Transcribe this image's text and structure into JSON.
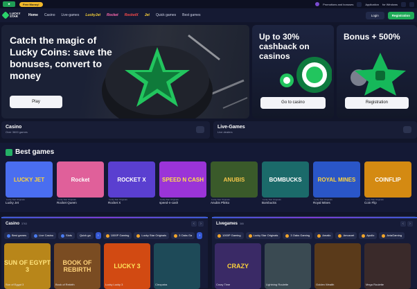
{
  "topbar": {
    "promo": "Free Money!",
    "account_text": "Promotions and bonuses",
    "app_label": "Application",
    "app_sub": "for Windows"
  },
  "nav": {
    "logo_line1": "LUCKY",
    "logo_line2": "STAR",
    "items": [
      "Home",
      "Casino",
      "Live-games",
      "LuckyJet",
      "Rocket",
      "RocketX",
      "Jet",
      "Quick games",
      "Best games"
    ],
    "login": "Login",
    "register": "Registration"
  },
  "hero": {
    "title": "Catch the magic of Lucky Coins: save the bonuses, convert to money",
    "button": "Play"
  },
  "promos": [
    {
      "title": "Up to 30% cashback on casinos",
      "button": "Go to casino"
    },
    {
      "title": "Bonus + 500%",
      "button": "Registration"
    }
  ],
  "categories": [
    {
      "title": "Casino",
      "sub": "Over 3600 games"
    },
    {
      "title": "Live-Games",
      "sub": "Live dealers"
    }
  ],
  "best": {
    "title": "Best games",
    "games": [
      {
        "name": "Lucky Jet",
        "provider": "Lucky Star Originals",
        "thumb": "LUCKY JET",
        "color": "#4a6ef0"
      },
      {
        "name": "Rocket Queen",
        "provider": "Lucky Star Originals",
        "thumb": "Rocket",
        "color": "#e0609a"
      },
      {
        "name": "Rocket X",
        "provider": "Lucky Star Originals",
        "thumb": "ROCKET X",
        "color": "#5a3fd0"
      },
      {
        "name": "speed-n-cash",
        "provider": "Lucky Star Originals",
        "thumb": "SPEED N CASH",
        "color": "#9a34d8"
      },
      {
        "name": "Anubis Plinko",
        "provider": "Lucky Star Originals",
        "thumb": "ANUBIS",
        "color": "#3a5a2a"
      },
      {
        "name": "Bombucks",
        "provider": "Lucky Star Originals",
        "thumb": "BOMBUCKS",
        "color": "#1b6a6a"
      },
      {
        "name": "Royal Mines",
        "provider": "Lucky Star Originals",
        "thumb": "ROYAL MINES",
        "color": "#2a56c8"
      },
      {
        "name": "Coin Flip",
        "provider": "Lucky Star Originals",
        "thumb": "COINFLIP",
        "color": "#d48a12"
      }
    ]
  },
  "casino_panel": {
    "title": "Casino",
    "count": "3763",
    "chips": [
      "Best games",
      "Live Casino",
      "Slots",
      "Quick ga",
      "1000P Gaming",
      "Lucky Star Originals",
      "3 Oaks Ga"
    ],
    "tiles": [
      {
        "label": "SUN OF EGYPT 3",
        "name": "Sun of Egypt 3",
        "color": "#b8861a"
      },
      {
        "label": "BOOK OF REBIRTH",
        "name": "Book of Rebirth",
        "color": "#7a4c22"
      },
      {
        "label": "LUCKY 3",
        "name": "Lucky Lucky 3",
        "color": "#d24a12"
      },
      {
        "label": "",
        "name": "Cleopatra",
        "color": "#1e4a58"
      }
    ]
  },
  "live_panel": {
    "title": "Livegames",
    "count": "365",
    "chips": [
      "1000P Gaming",
      "Lucky Star Originals",
      "3 Oaks Gaming",
      "Amatic",
      "Amusnet",
      "Apollo",
      "AviaGaming"
    ],
    "tiles": [
      {
        "label": "CRAZY",
        "name": "Crazy Time",
        "color": "#3a2a66"
      },
      {
        "label": "",
        "name": "Lightning Roulette",
        "color": "#3a4a52"
      },
      {
        "label": "",
        "name": "Golden Wealth",
        "color": "#5a3a1a"
      },
      {
        "label": "",
        "name": "Mega Roulette",
        "color": "#3a2a2a"
      }
    ]
  }
}
